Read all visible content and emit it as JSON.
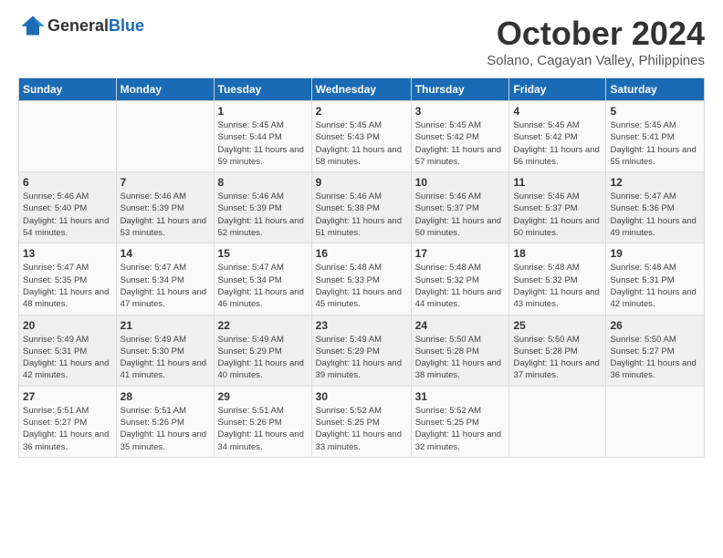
{
  "logo": {
    "general": "General",
    "blue": "Blue"
  },
  "header": {
    "month": "October 2024",
    "location": "Solano, Cagayan Valley, Philippines"
  },
  "weekdays": [
    "Sunday",
    "Monday",
    "Tuesday",
    "Wednesday",
    "Thursday",
    "Friday",
    "Saturday"
  ],
  "weeks": [
    [
      {
        "day": "",
        "info": ""
      },
      {
        "day": "",
        "info": ""
      },
      {
        "day": "1",
        "info": "Sunrise: 5:45 AM\nSunset: 5:44 PM\nDaylight: 11 hours and 59 minutes."
      },
      {
        "day": "2",
        "info": "Sunrise: 5:45 AM\nSunset: 5:43 PM\nDaylight: 11 hours and 58 minutes."
      },
      {
        "day": "3",
        "info": "Sunrise: 5:45 AM\nSunset: 5:42 PM\nDaylight: 11 hours and 57 minutes."
      },
      {
        "day": "4",
        "info": "Sunrise: 5:45 AM\nSunset: 5:42 PM\nDaylight: 11 hours and 56 minutes."
      },
      {
        "day": "5",
        "info": "Sunrise: 5:45 AM\nSunset: 5:41 PM\nDaylight: 11 hours and 55 minutes."
      }
    ],
    [
      {
        "day": "6",
        "info": "Sunrise: 5:46 AM\nSunset: 5:40 PM\nDaylight: 11 hours and 54 minutes."
      },
      {
        "day": "7",
        "info": "Sunrise: 5:46 AM\nSunset: 5:39 PM\nDaylight: 11 hours and 53 minutes."
      },
      {
        "day": "8",
        "info": "Sunrise: 5:46 AM\nSunset: 5:39 PM\nDaylight: 11 hours and 52 minutes."
      },
      {
        "day": "9",
        "info": "Sunrise: 5:46 AM\nSunset: 5:38 PM\nDaylight: 11 hours and 51 minutes."
      },
      {
        "day": "10",
        "info": "Sunrise: 5:46 AM\nSunset: 5:37 PM\nDaylight: 11 hours and 50 minutes."
      },
      {
        "day": "11",
        "info": "Sunrise: 5:46 AM\nSunset: 5:37 PM\nDaylight: 11 hours and 50 minutes."
      },
      {
        "day": "12",
        "info": "Sunrise: 5:47 AM\nSunset: 5:36 PM\nDaylight: 11 hours and 49 minutes."
      }
    ],
    [
      {
        "day": "13",
        "info": "Sunrise: 5:47 AM\nSunset: 5:35 PM\nDaylight: 11 hours and 48 minutes."
      },
      {
        "day": "14",
        "info": "Sunrise: 5:47 AM\nSunset: 5:34 PM\nDaylight: 11 hours and 47 minutes."
      },
      {
        "day": "15",
        "info": "Sunrise: 5:47 AM\nSunset: 5:34 PM\nDaylight: 11 hours and 46 minutes."
      },
      {
        "day": "16",
        "info": "Sunrise: 5:48 AM\nSunset: 5:33 PM\nDaylight: 11 hours and 45 minutes."
      },
      {
        "day": "17",
        "info": "Sunrise: 5:48 AM\nSunset: 5:32 PM\nDaylight: 11 hours and 44 minutes."
      },
      {
        "day": "18",
        "info": "Sunrise: 5:48 AM\nSunset: 5:32 PM\nDaylight: 11 hours and 43 minutes."
      },
      {
        "day": "19",
        "info": "Sunrise: 5:48 AM\nSunset: 5:31 PM\nDaylight: 11 hours and 42 minutes."
      }
    ],
    [
      {
        "day": "20",
        "info": "Sunrise: 5:49 AM\nSunset: 5:31 PM\nDaylight: 11 hours and 42 minutes."
      },
      {
        "day": "21",
        "info": "Sunrise: 5:49 AM\nSunset: 5:30 PM\nDaylight: 11 hours and 41 minutes."
      },
      {
        "day": "22",
        "info": "Sunrise: 5:49 AM\nSunset: 5:29 PM\nDaylight: 11 hours and 40 minutes."
      },
      {
        "day": "23",
        "info": "Sunrise: 5:49 AM\nSunset: 5:29 PM\nDaylight: 11 hours and 39 minutes."
      },
      {
        "day": "24",
        "info": "Sunrise: 5:50 AM\nSunset: 5:28 PM\nDaylight: 11 hours and 38 minutes."
      },
      {
        "day": "25",
        "info": "Sunrise: 5:50 AM\nSunset: 5:28 PM\nDaylight: 11 hours and 37 minutes."
      },
      {
        "day": "26",
        "info": "Sunrise: 5:50 AM\nSunset: 5:27 PM\nDaylight: 11 hours and 36 minutes."
      }
    ],
    [
      {
        "day": "27",
        "info": "Sunrise: 5:51 AM\nSunset: 5:27 PM\nDaylight: 11 hours and 36 minutes."
      },
      {
        "day": "28",
        "info": "Sunrise: 5:51 AM\nSunset: 5:26 PM\nDaylight: 11 hours and 35 minutes."
      },
      {
        "day": "29",
        "info": "Sunrise: 5:51 AM\nSunset: 5:26 PM\nDaylight: 11 hours and 34 minutes."
      },
      {
        "day": "30",
        "info": "Sunrise: 5:52 AM\nSunset: 5:25 PM\nDaylight: 11 hours and 33 minutes."
      },
      {
        "day": "31",
        "info": "Sunrise: 5:52 AM\nSunset: 5:25 PM\nDaylight: 11 hours and 32 minutes."
      },
      {
        "day": "",
        "info": ""
      },
      {
        "day": "",
        "info": ""
      }
    ]
  ]
}
